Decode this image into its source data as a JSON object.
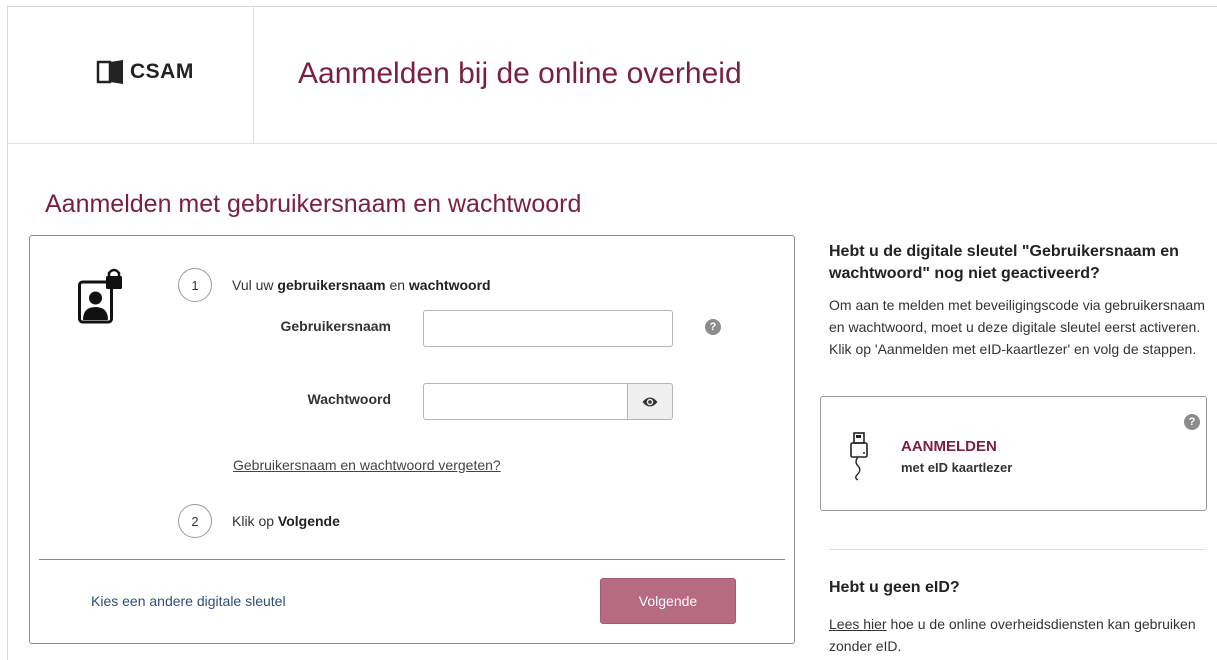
{
  "header": {
    "logo_text": "CSAM",
    "title": "Aanmelden bij de online overheid"
  },
  "main": {
    "title": "Aanmelden met gebruikersnaam en wachtwoord",
    "step1": {
      "number": "1",
      "prefix": "Vul uw ",
      "bold1": "gebruikersnaam",
      "middle": " en ",
      "bold2": "wachtwoord"
    },
    "username_label": "Gebruikersnaam",
    "username_value": "",
    "password_label": "Wachtwoord",
    "password_value": "",
    "forgot_link": "Gebruikersnaam en wachtwoord vergeten?",
    "step2": {
      "number": "2",
      "prefix": "Klik op ",
      "bold": "Volgende"
    },
    "other_key_link": "Kies een andere digitale sleutel",
    "next_button": "Volgende"
  },
  "sidebar": {
    "heading": "Hebt u de digitale sleutel \"Gebruikersnaam en wachtwoord\" nog niet geactiveerd?",
    "text": "Om aan te melden met beveiligingscode via gebruikersnaam en wachtwoord, moet u deze digitale sleutel eerst activeren. Klik op 'Aanmelden met eID-kaartlezer' en volg de stappen.",
    "eid_card": {
      "title": "AANMELDEN",
      "subtitle": "met eID kaartlezer"
    },
    "no_eid_heading": "Hebt u geen eID?",
    "no_eid_link": "Lees hier",
    "no_eid_text": " hoe u de online overheidsdiensten kan gebruiken zonder eID."
  },
  "icons": {
    "help": "question-circle-icon",
    "eye": "eye-icon",
    "user_lock": "user-lock-icon",
    "card_reader": "card-reader-icon"
  },
  "colors": {
    "brand": "#7b1f3e",
    "button": "#b66b83",
    "link": "#2e4d7a"
  }
}
